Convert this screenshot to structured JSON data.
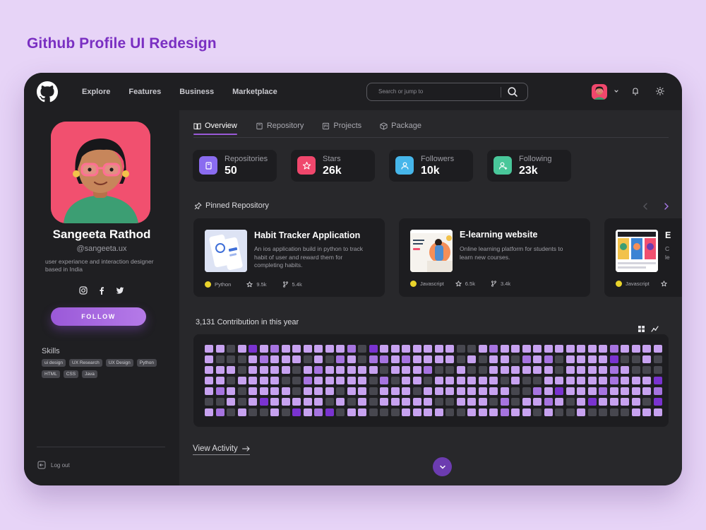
{
  "heading": "Github Profile UI Redesign",
  "nav": [
    "Explore",
    "Features",
    "Business",
    "Marketplace"
  ],
  "search": {
    "placeholder": "Search or jump to"
  },
  "profile": {
    "name": "Sangeeta Rathod",
    "handle": "@sangeeta.ux",
    "bio": "user experiance and interaction designer based in India",
    "follow_label": "FOLLOW",
    "skills_title": "Skills",
    "skills": [
      "ui design",
      "UX Research",
      "UX Design",
      "Python",
      "HTML",
      "CSS",
      "Java"
    ],
    "socials": [
      "instagram-icon",
      "facebook-icon",
      "twitter-icon"
    ],
    "logout_label": "Log out"
  },
  "tabs": [
    {
      "label": "Overview",
      "icon": "book-icon",
      "active": true
    },
    {
      "label": "Repository",
      "icon": "repo-icon",
      "active": false
    },
    {
      "label": "Projects",
      "icon": "project-icon",
      "active": false
    },
    {
      "label": "Package",
      "icon": "package-icon",
      "active": false
    }
  ],
  "stats": [
    {
      "label": "Repositories",
      "value": "50",
      "color": "#8a6cf0",
      "icon": "repo-icon"
    },
    {
      "label": "Stars",
      "value": "26k",
      "color": "#f0476c",
      "icon": "star-icon"
    },
    {
      "label": "Followers",
      "value": "10k",
      "color": "#46b6ea",
      "icon": "user-icon"
    },
    {
      "label": "Following",
      "value": "23k",
      "color": "#49c79a",
      "icon": "user-plus-icon"
    }
  ],
  "pinned_title": "Pinned Repository",
  "repos": [
    {
      "title": "Habit Tracker Application",
      "desc": "An ios application build in python to track habit of user and reward them for completing habits.",
      "lang": "Python",
      "stars": "9.5k",
      "forks": "5.4k"
    },
    {
      "title": "E-learning website",
      "desc": "Online learning platform for students to learn new courses.",
      "lang": "Javascript",
      "stars": "6.5k",
      "forks": "3.4k"
    },
    {
      "title": "E",
      "desc": "C le",
      "lang": "Javascript",
      "stars": "",
      "forks": ""
    }
  ],
  "contributions": {
    "title": "3,131 Contribution in this year",
    "colors": [
      "#47474f",
      "#c7a2f0",
      "#a674e0",
      "#7a33d0"
    ],
    "rows": 7,
    "cols": 42,
    "levels": [
      "1101312111111203111111100121111111111211111",
      "1000121110102102212111101011021201111300101",
      "1110111101211111011120010011111101111210000",
      "1101111002111110201101111110100111111211130",
      "1210111101110110111011111111002131112111121",
      "0010131111101010111110011102011210131111031",
      "1201001031230110001111001112110100100001111"
    ]
  },
  "view_activity": "View Activity"
}
